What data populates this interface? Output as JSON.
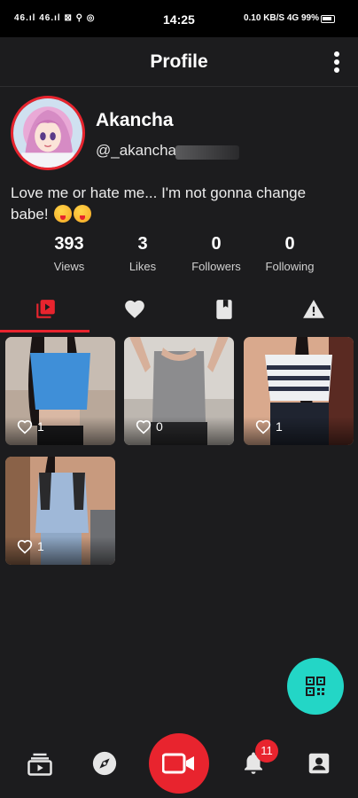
{
  "status_bar": {
    "left": "46.ıl 46.ıl ⊠ ⚲ ◎",
    "time": "14:25",
    "right": "0.10 KB/S 4G 99%"
  },
  "header": {
    "title": "Profile",
    "menu_icon": "more-vertical-icon"
  },
  "profile": {
    "name": "Akancha",
    "handle": "@_akancha",
    "bio": "Love me or hate me... I'm not gonna change babe!"
  },
  "stats": [
    {
      "value": "393",
      "label": "Views"
    },
    {
      "value": "3",
      "label": "Likes"
    },
    {
      "value": "0",
      "label": "Followers"
    },
    {
      "value": "0",
      "label": "Following"
    }
  ],
  "tabs": [
    {
      "icon": "video-library-icon",
      "active": true
    },
    {
      "icon": "heart-icon",
      "active": false
    },
    {
      "icon": "bookmark-icon",
      "active": false
    },
    {
      "icon": "warning-icon",
      "active": false
    }
  ],
  "videos": [
    {
      "likes": "1"
    },
    {
      "likes": "0"
    },
    {
      "likes": "1"
    },
    {
      "likes": "1"
    }
  ],
  "fab_icon": "qr-code-icon",
  "bottom_nav": [
    {
      "icon": "feed-icon"
    },
    {
      "icon": "compass-icon"
    },
    {
      "icon": "video-camera-icon"
    },
    {
      "icon": "bell-icon",
      "badge": "11"
    },
    {
      "icon": "profile-icon"
    }
  ],
  "colors": {
    "accent": "#e8242e",
    "fab": "#23d6c6",
    "background": "#1c1c1e"
  }
}
